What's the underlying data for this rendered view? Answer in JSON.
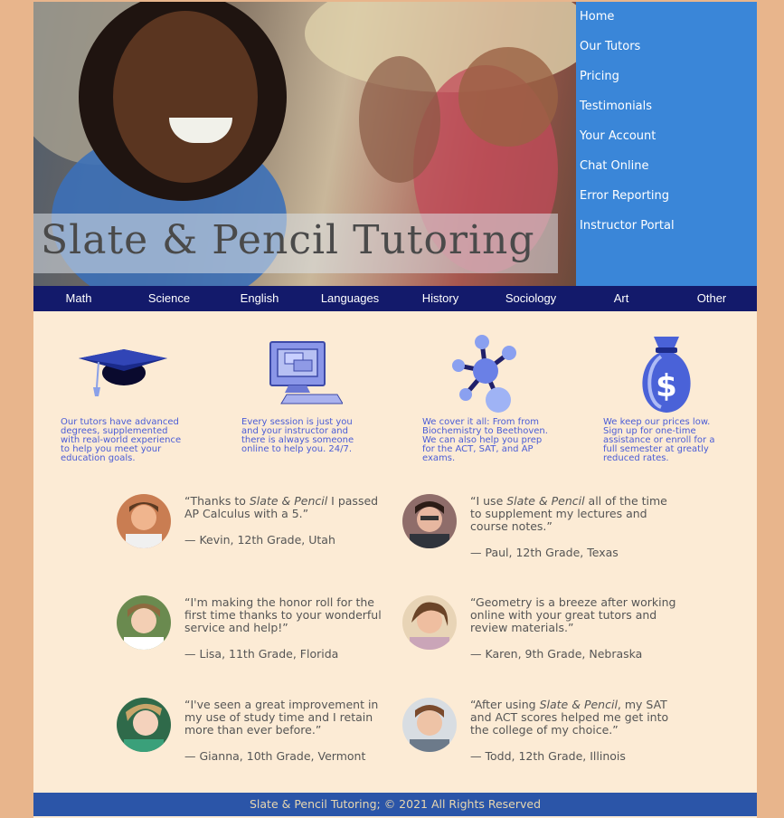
{
  "brand": {
    "title": "Slate & Pencil Tutoring"
  },
  "side_nav": {
    "items": [
      {
        "label": "Home"
      },
      {
        "label": "Our Tutors"
      },
      {
        "label": "Pricing"
      },
      {
        "label": "Testimonials"
      },
      {
        "label": "Your Account"
      },
      {
        "label": "Chat Online"
      },
      {
        "label": "Error Reporting"
      },
      {
        "label": "Instructor Portal"
      }
    ]
  },
  "subjects": {
    "items": [
      {
        "label": "Math"
      },
      {
        "label": "Science"
      },
      {
        "label": "English"
      },
      {
        "label": "Languages"
      },
      {
        "label": "History"
      },
      {
        "label": "Sociology"
      },
      {
        "label": "Art"
      },
      {
        "label": "Other"
      }
    ]
  },
  "features": [
    {
      "icon": "graduation-cap-icon",
      "text": "Our tutors have advanced degrees, supplemented with real-world experience to help you meet your education goals."
    },
    {
      "icon": "computer-icon",
      "text": "Every session is just you and your instructor and there is always someone online to help you. 24/7."
    },
    {
      "icon": "molecule-icon",
      "text": "We cover it all: From from Biochemistry to Beethoven. We can also help you prep for the ACT, SAT, and AP exams."
    },
    {
      "icon": "money-bag-icon",
      "text": "We keep our prices low. Sign up for one-time assistance or enroll for a full semester at greatly reduced rates."
    }
  ],
  "testimonials": [
    {
      "quote_pre": "“Thanks to ",
      "quote_em": "Slate & Pencil",
      "quote_post": " I passed AP Calculus with a 5.”",
      "author": "— Kevin, 12th Grade, Utah"
    },
    {
      "quote_pre": "“I use ",
      "quote_em": "Slate & Pencil",
      "quote_post": " all of the time to supplement my lectures and course notes.”",
      "author": "— Paul, 12th Grade, Texas"
    },
    {
      "quote_pre": "“I'm making the honor roll for the first time thanks to your wonderful service and help!”",
      "quote_em": "",
      "quote_post": "",
      "author": "— Lisa, 11th Grade, Florida"
    },
    {
      "quote_pre": "“Geometry is a breeze after working online with your great tutors and review materials.”",
      "quote_em": "",
      "quote_post": "",
      "author": "— Karen, 9th Grade, Nebraska"
    },
    {
      "quote_pre": "“I've seen a great improvement in my use of study time and I retain more than ever before.”",
      "quote_em": "",
      "quote_post": "",
      "author": "— Gianna, 10th Grade, Vermont"
    },
    {
      "quote_pre": "“After using ",
      "quote_em": "Slate & Pencil",
      "quote_post": ", my SAT and ACT scores helped me get into the college of my choice.”",
      "author": "— Todd, 12th Grade, Illinois"
    }
  ],
  "footer": {
    "text": "Slate & Pencil Tutoring; © 2021 All Rights Reserved"
  },
  "colors": {
    "side_nav": "#3a86d8",
    "subject_bar": "#131a6b",
    "footer": "#2b55a8",
    "page": "#fcebd5",
    "outer": "#e8b58c"
  }
}
